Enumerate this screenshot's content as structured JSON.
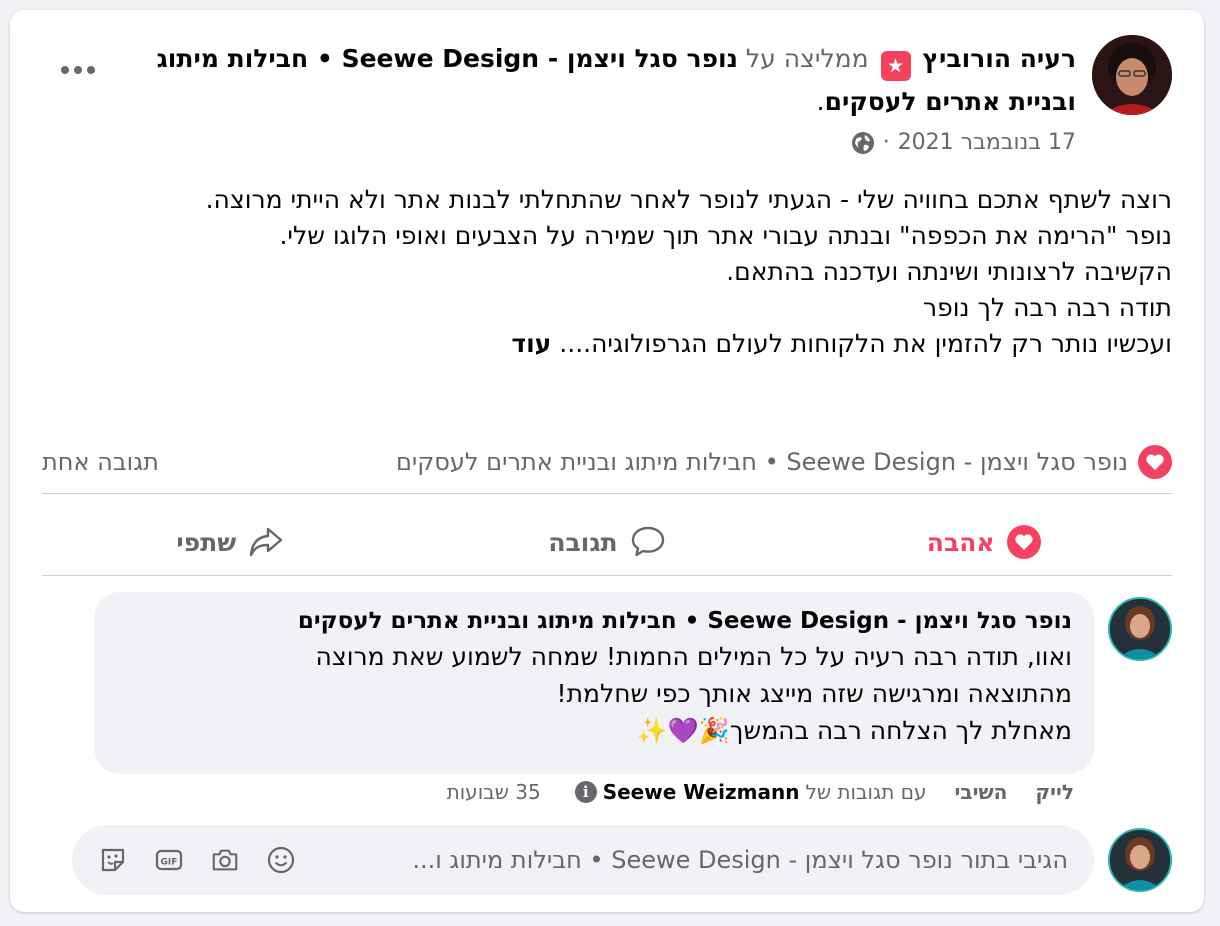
{
  "post": {
    "author": "רעיה הורוביץ",
    "recommends_text": "ממליצה על",
    "page_name": "נופר סגל ויצמן - Seewe Design • חבילות מיתוג ובניית אתרים לעסקים",
    "date": "17 בנובמבר 2021",
    "separator": "·",
    "body_lines": [
      "רוצה לשתף אתכם בחוויה שלי - הגעתי לנופר לאחר שהתחלתי לבנות אתר ולא הייתי מרוצה.",
      "נופר \"הרימה את הכפפה\" ובנתה עבורי אתר תוך שמירה על הצבעים ואופי הלוגו שלי.",
      "הקשיבה לרצונותי ושינתה ועדכנה בהתאם.",
      "תודה רבה רבה לך נופר",
      "ועכשיו נותר רק להזמין את הלקוחות לעולם הגרפולוגיה...."
    ],
    "see_more": "עוד",
    "icons": {
      "recommend": "recommend-star-icon",
      "privacy": "globe-icon",
      "more": "more-dots-icon"
    }
  },
  "summary": {
    "reactor": "נופר סגל ויצמן - Seewe Design • חבילות מיתוג ובניית אתרים לעסקים",
    "comments_count": "תגובה אחת"
  },
  "actions": {
    "love": "אהבה",
    "comment": "תגובה",
    "share": "שתפי"
  },
  "comment": {
    "author": "נופר סגל ויצמן - Seewe Design • חבילות מיתוג ובניית אתרים לעסקים",
    "text_lines": [
      "ואוו, תודה רבה רעיה על כל המילים החמות! שמחה לשמוע שאת מרוצה",
      "מהתוצאה ומרגישה שזה מייצג אותך כפי שחלמת!",
      "מאחלת לך הצלחה רבה בהמשך🎉💜✨"
    ],
    "like": "לייק",
    "reply": "השיבי",
    "note_prefix": "עם תגובות של",
    "note_name": "Seewe Weizmann",
    "time": "35 שבועות"
  },
  "composer": {
    "placeholder": "הגיבי בתור נופר סגל ויצמן - Seewe Design • חבילות מיתוג ו..."
  },
  "colors": {
    "love": "#f3425f",
    "muted": "#65676b",
    "text": "#050505",
    "bubble": "#f0f2f5"
  }
}
